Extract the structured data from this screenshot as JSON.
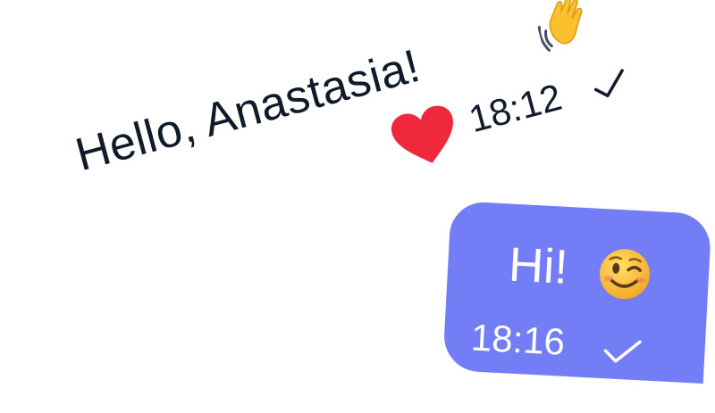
{
  "incoming": {
    "text": "Hello, Anastasia!",
    "emoji": "waving-hand-icon",
    "reaction": "heart-icon",
    "time": "18:12",
    "status": "check-icon"
  },
  "outgoing": {
    "text": "Hi!",
    "emoji": "winking-face-icon",
    "time": "18:16",
    "status": "check-icon"
  },
  "colors": {
    "text": "#0f1a2b",
    "bubble": "#737ef6",
    "bubble_text": "#ffffff",
    "heart": "#f0283c",
    "emoji_yellow": "#fbc02d"
  }
}
